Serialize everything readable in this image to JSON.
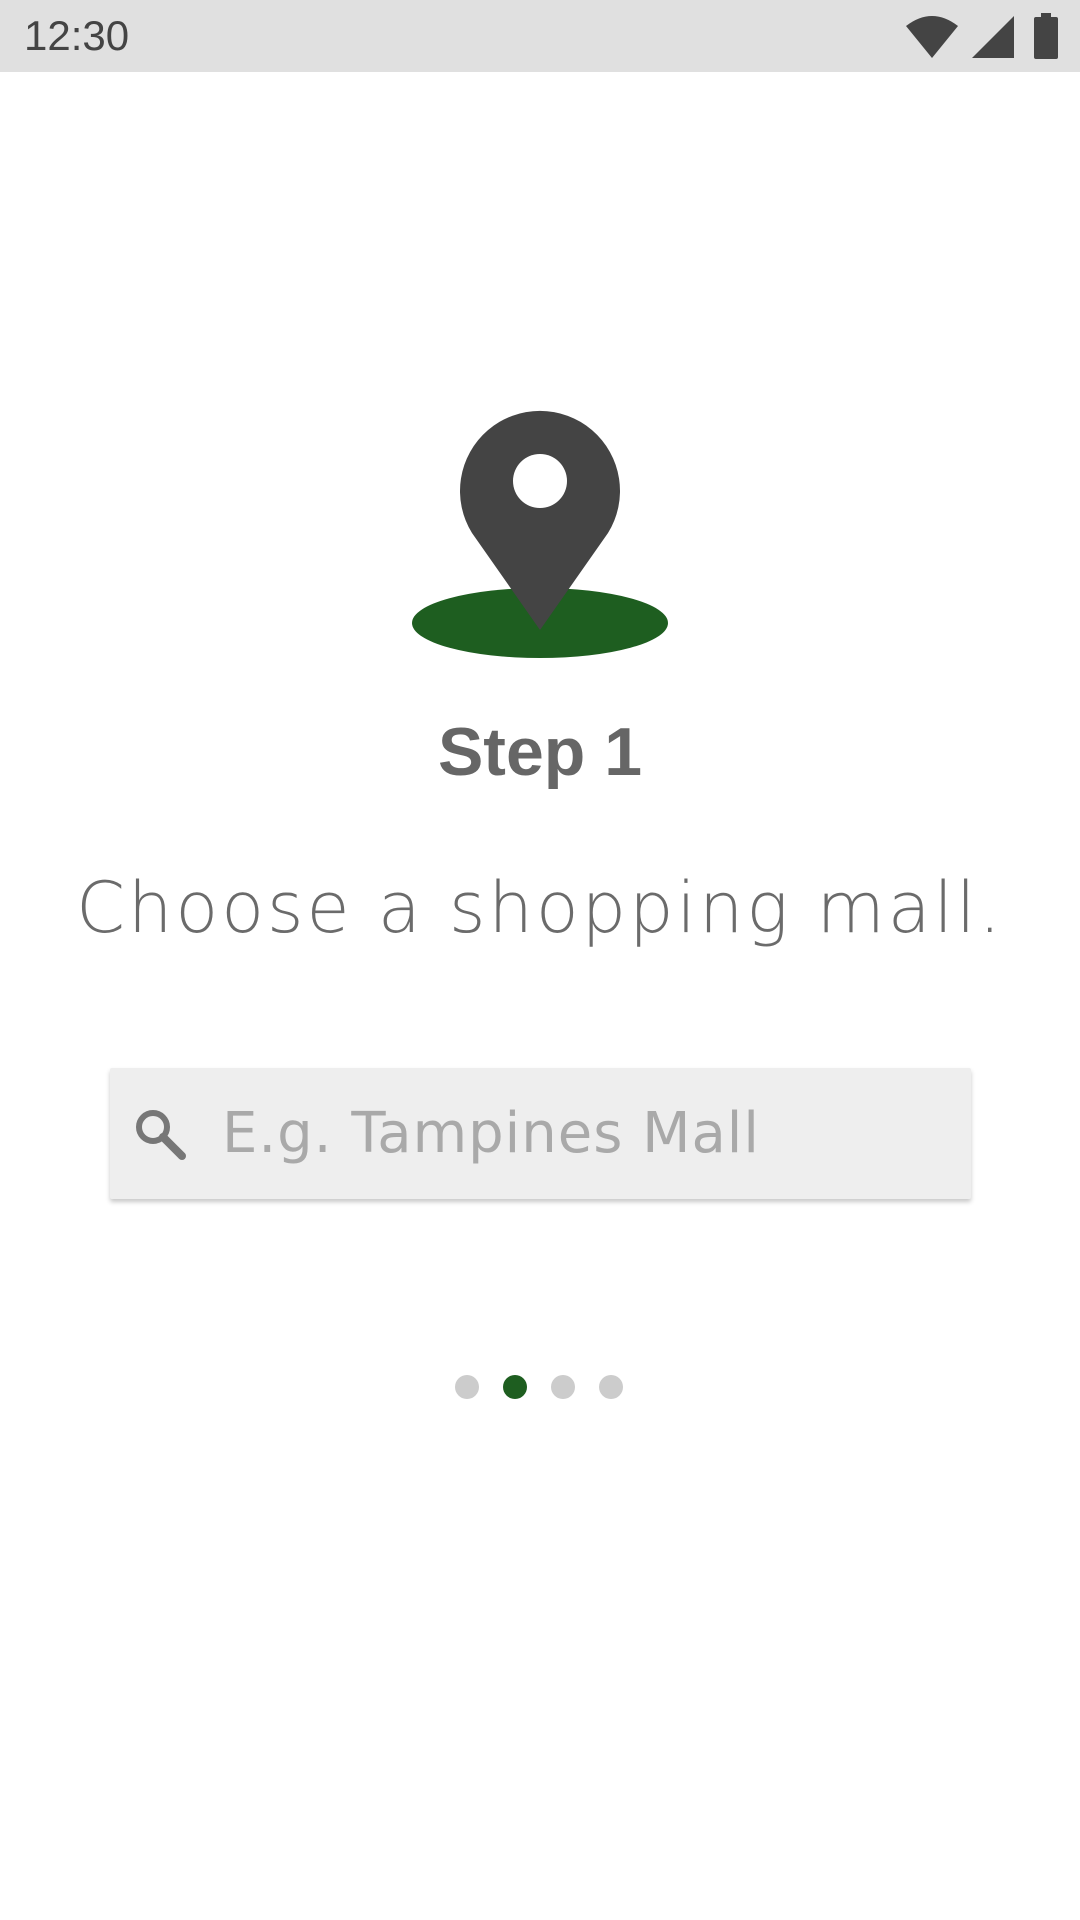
{
  "status_bar": {
    "time": "12:30",
    "icons": [
      "wifi-icon",
      "signal-icon",
      "battery-icon"
    ]
  },
  "hero": {
    "icon": "location-pin-icon",
    "pin_color": "#444444",
    "ground_color": "#1e5e20"
  },
  "step": {
    "title": "Step 1",
    "description": "Choose a shopping mall."
  },
  "search": {
    "icon": "search-icon",
    "placeholder": "E.g. Tampines Mall",
    "value": ""
  },
  "pager": {
    "count": 4,
    "active_index": 1,
    "active_color": "#1e5e20",
    "inactive_color": "#cccccc"
  }
}
